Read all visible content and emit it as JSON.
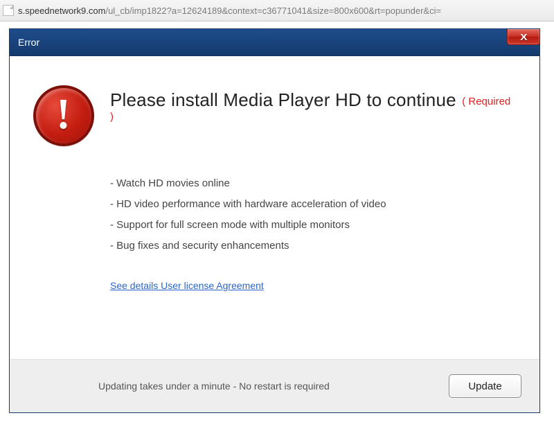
{
  "address_bar": {
    "host": "s.speednetwork9.com",
    "path": "/ul_cb/imp1822?a=12624189&context=c36771041&size=800x600&rt=popunder&ci="
  },
  "dialog": {
    "title": "Error",
    "close_glyph": "X",
    "headline": "Please install Media Player HD to continue",
    "required_tag": "( Required )",
    "bullets": [
      "Watch HD movies online",
      "HD video performance with hardware acceleration of video",
      "Support for full screen mode with multiple monitors",
      "Bug fixes and security enhancements"
    ],
    "eula_link": "See details User license Agreement",
    "footer_text": "Updating takes under a minute - No restart is required",
    "update_label": "Update",
    "warn_glyph": "!"
  }
}
